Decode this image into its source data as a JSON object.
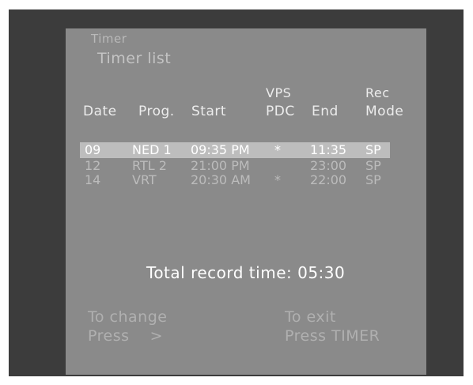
{
  "header": {
    "title": "Timer",
    "subtitle": "Timer list"
  },
  "columns": {
    "date": "Date",
    "prog": "Prog.",
    "start": "Start",
    "vps_top": "VPS",
    "vps_bottom": "PDC",
    "end": "End",
    "rec_top": "Rec",
    "rec_bottom": "Mode"
  },
  "rows": [
    {
      "date": "09",
      "prog": "NED 1",
      "start": "09:35 PM",
      "vps": "*",
      "end": "11:35",
      "mode": "SP"
    },
    {
      "date": "12",
      "prog": "RTL 2",
      "start": "21:00 PM",
      "vps": "",
      "end": "23:00",
      "mode": "SP"
    },
    {
      "date": "14",
      "prog": "VRT",
      "start": "20:30 AM",
      "vps": "*",
      "end": "22:00",
      "mode": "SP"
    }
  ],
  "total": "Total record time: 05:30",
  "footer": {
    "change_line1": "To change",
    "change_line2": "Press    >",
    "exit_line1": "To exit",
    "exit_line2": "Press TIMER"
  },
  "colors": {
    "outer_frame": "#3c3c3c",
    "screen": "#8a8a8a",
    "highlight": "#bdbdbd"
  }
}
